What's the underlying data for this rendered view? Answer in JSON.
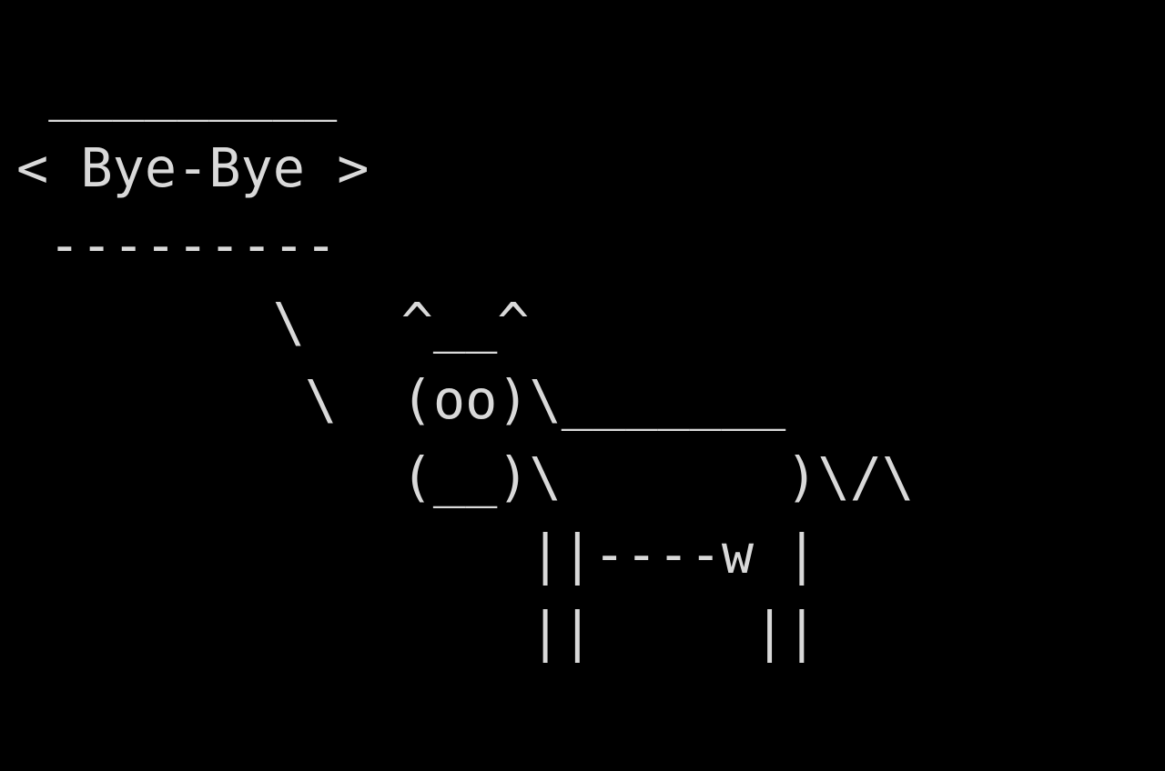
{
  "terminal": {
    "background": "#000000",
    "foreground": "#d9d9d9",
    "output_lines": [
      " _________",
      "< Bye-Bye >",
      " ---------",
      "        \\   ^__^",
      "         \\  (oo)\\_______",
      "            (__)\\       )\\/\\",
      "                ||----w |",
      "                ||     ||"
    ]
  }
}
